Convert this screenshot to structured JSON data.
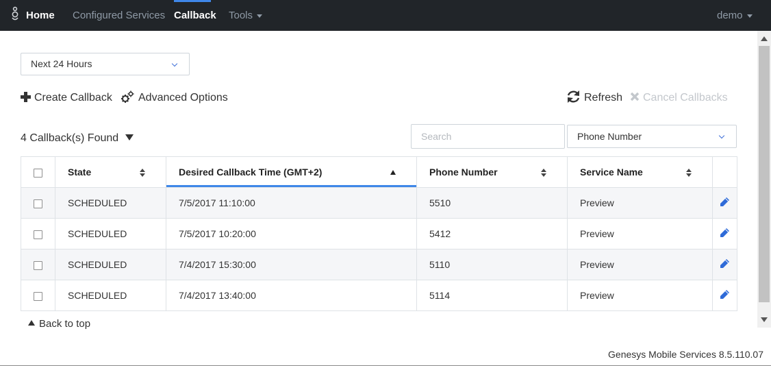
{
  "nav": {
    "brand_icon": "genesys-logo-icon",
    "home": "Home",
    "configured_services": "Configured Services",
    "callback": "Callback",
    "tools": "Tools",
    "user": "demo"
  },
  "filters": {
    "range": "Next 24 Hours"
  },
  "toolbar": {
    "create": "Create Callback",
    "advanced": "Advanced Options",
    "refresh": "Refresh",
    "cancel": "Cancel Callbacks"
  },
  "results": {
    "found": "4 Callback(s) Found"
  },
  "search": {
    "placeholder": "Search",
    "field": "Phone Number"
  },
  "table": {
    "headers": {
      "state": "State",
      "time": "Desired Callback Time (GMT+2)",
      "phone": "Phone Number",
      "service": "Service Name"
    },
    "rows": [
      {
        "state": "SCHEDULED",
        "time": "7/5/2017 11:10:00",
        "phone": "5510",
        "service": "Preview"
      },
      {
        "state": "SCHEDULED",
        "time": "7/5/2017 10:20:00",
        "phone": "5412",
        "service": "Preview"
      },
      {
        "state": "SCHEDULED",
        "time": "7/4/2017 15:30:00",
        "phone": "5110",
        "service": "Preview"
      },
      {
        "state": "SCHEDULED",
        "time": "7/4/2017 13:40:00",
        "phone": "5114",
        "service": "Preview"
      }
    ]
  },
  "back_to_top": "Back to top",
  "footer": "Genesys Mobile Services 8.5.110.07",
  "colors": {
    "navbar": "#212529",
    "accent": "#3f87e8",
    "edit_icon": "#2f6bd8"
  }
}
